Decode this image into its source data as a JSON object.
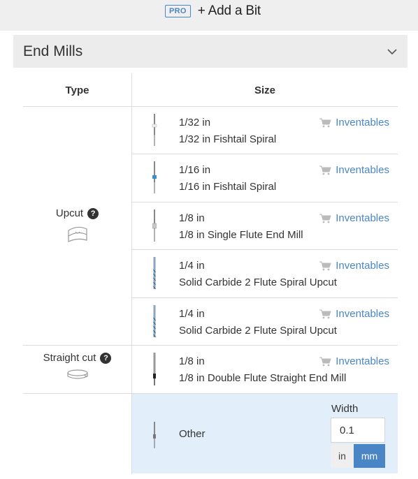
{
  "toolbar": {
    "pro_badge": "PRO",
    "add_bit_label": "+ Add a Bit"
  },
  "section": {
    "title": "End Mills"
  },
  "table": {
    "headers": {
      "type": "Type",
      "size": "Size"
    },
    "types": [
      {
        "label": "Upcut",
        "help": "?"
      },
      {
        "label": "Straight cut",
        "help": "?"
      }
    ],
    "rows": [
      {
        "size": "1/32 in",
        "name": "1/32 in Fishtail Spiral",
        "vendor": "Inventables"
      },
      {
        "size": "1/16 in",
        "name": "1/16 in Fishtail Spiral",
        "vendor": "Inventables"
      },
      {
        "size": "1/8 in",
        "name": "1/8 in Single Flute End Mill",
        "vendor": "Inventables"
      },
      {
        "size": "1/4 in",
        "name": "Solid Carbide 2 Flute Spiral Upcut",
        "vendor": "Inventables"
      },
      {
        "size": "1/4 in",
        "name": "Solid Carbide 2 Flute Spiral Upcut",
        "vendor": "Inventables"
      },
      {
        "size": "1/8 in",
        "name": "1/8 in Double Flute Straight End Mill",
        "vendor": "Inventables"
      }
    ],
    "other": {
      "label": "Other",
      "width_label": "Width",
      "width_value": "0.1",
      "unit_in": "in",
      "unit_mm": "mm",
      "selected_unit": "mm"
    }
  },
  "colors": {
    "accent": "#4a86c5",
    "selected_row_bg": "#e2eefa",
    "header_bg": "#ececec"
  }
}
